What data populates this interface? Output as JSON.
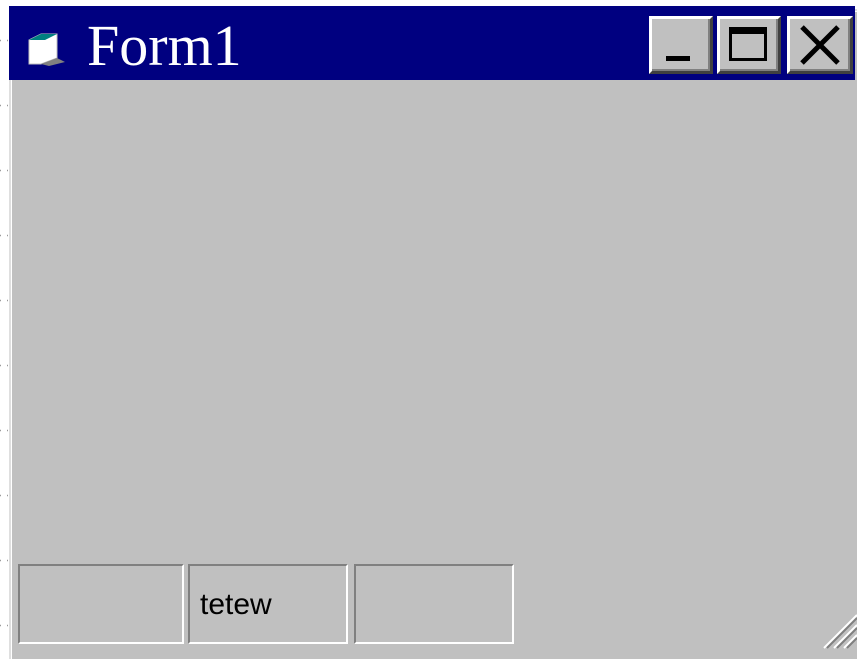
{
  "window": {
    "title": "Form1",
    "icon": "form-icon",
    "buttons": {
      "minimize": "minimize-icon",
      "maximize": "maximize-icon",
      "close": "close-icon"
    }
  },
  "statusbar": {
    "panels": [
      {
        "text": ""
      },
      {
        "text": "tetew"
      },
      {
        "text": ""
      }
    ]
  },
  "colors": {
    "titlebar": "#000080",
    "face": "#c0c0c0",
    "title_text": "#ffffff"
  }
}
